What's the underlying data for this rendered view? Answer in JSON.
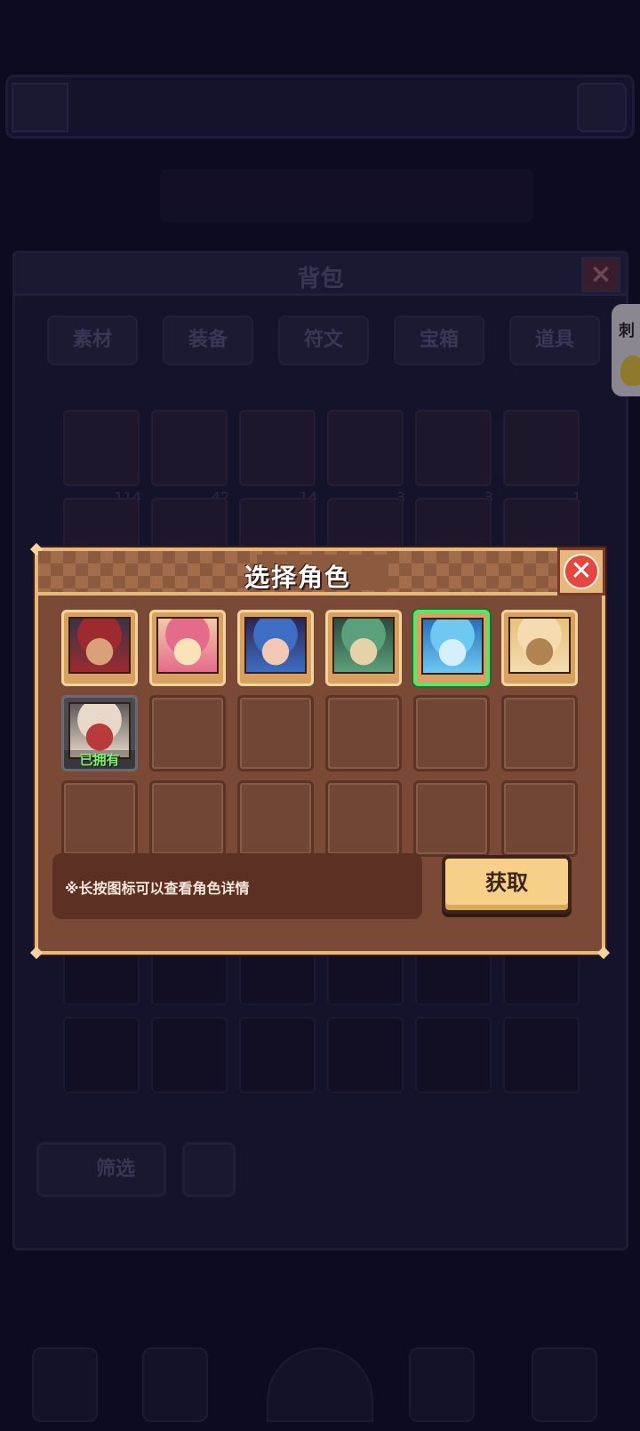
{
  "background": {
    "bag_title": "背包",
    "bag_tabs": [
      "素材",
      "装备",
      "符文",
      "宝箱",
      "道具"
    ],
    "bag_items": [
      {
        "qty": "114"
      },
      {
        "qty": "42"
      },
      {
        "qty": "14"
      },
      {
        "qty": "3"
      },
      {
        "qty": "3"
      },
      {
        "qty": "1"
      },
      {
        "qty": ""
      },
      {
        "qty": ""
      },
      {
        "qty": ""
      },
      {
        "qty": ""
      },
      {
        "qty": ""
      },
      {
        "qty": ""
      }
    ],
    "filter_label": "筛选",
    "side_tab_label": "刺"
  },
  "modal": {
    "title": "选择角色",
    "close_symbol": "✕",
    "characters": [
      {
        "id": "char-1",
        "name": "",
        "selected": false,
        "owned": false,
        "colors": [
          "#3b3346",
          "#9c2a2e",
          "#d9a07a"
        ]
      },
      {
        "id": "char-2",
        "name": "",
        "selected": false,
        "owned": false,
        "colors": [
          "#f4c9a8",
          "#e56b8a",
          "#fbe2b8"
        ]
      },
      {
        "id": "char-3",
        "name": "",
        "selected": false,
        "owned": false,
        "colors": [
          "#2c2550",
          "#3e6ec4",
          "#f0c8b4"
        ]
      },
      {
        "id": "char-4",
        "name": "",
        "selected": false,
        "owned": false,
        "colors": [
          "#2f4a3e",
          "#5aa07a",
          "#e6d2a8"
        ]
      },
      {
        "id": "char-5",
        "name": "",
        "selected": true,
        "owned": false,
        "colors": [
          "#2a6fb8",
          "#6ec8f2",
          "#d4f0ff"
        ]
      },
      {
        "id": "char-6",
        "name": "",
        "selected": false,
        "owned": false,
        "colors": [
          "#e7c27a",
          "#f4dcb0",
          "#b08450"
        ]
      },
      {
        "id": "char-7",
        "name": "",
        "selected": false,
        "owned": true,
        "owned_label": "已拥有",
        "colors": [
          "#5e5a5c",
          "#e8d8c8",
          "#b83a3a"
        ]
      }
    ],
    "empty_slots": 11,
    "hint": "※长按图标可以查看角色详情",
    "get_button": "获取"
  }
}
